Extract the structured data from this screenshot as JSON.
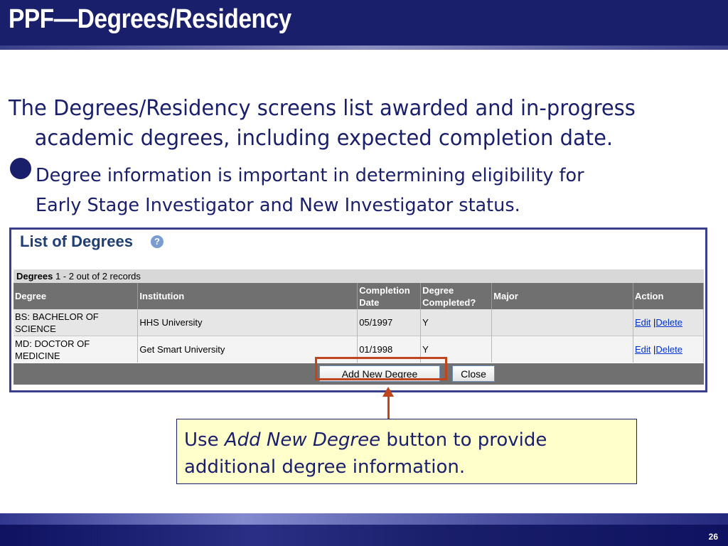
{
  "slide": {
    "title": "PPF—Degrees/Residency",
    "lead_line1": "The Degrees/Residency screens list awarded and in-progress",
    "lead_line2": "academic degrees, including expected completion date.",
    "bullet_line1": "Degree information is important in determining eligibility for",
    "bullet_line2": "Early Stage Investigator and New Investigator status.",
    "page_number": "26"
  },
  "screen": {
    "title": "List of Degrees",
    "records_label": "Degrees",
    "records_text": "1 - 2 out of 2 records",
    "columns": {
      "degree": "Degree",
      "institution": "Institution",
      "completion_l1": "Completion",
      "completion_l2": "Date",
      "completed_l1": "Degree",
      "completed_l2": "Completed?",
      "major": "Major",
      "action": "Action"
    },
    "rows": [
      {
        "degree_l1": "BS: BACHELOR OF",
        "degree_l2": "SCIENCE",
        "institution": "HHS University",
        "completion_date": "05/1997",
        "completed": "Y",
        "major": "",
        "edit": "Edit",
        "sep": "|",
        "delete": "Delete"
      },
      {
        "degree_l1": "MD: DOCTOR OF",
        "degree_l2": "MEDICINE",
        "institution": "Get Smart University",
        "completion_date": "01/1998",
        "completed": "Y",
        "major": "",
        "edit": "Edit",
        "sep": "|",
        "delete": "Delete"
      }
    ],
    "add_button": "Add New Degree",
    "close_button": "Close"
  },
  "callout": {
    "prefix": "Use",
    "emphasis": "Add New Degree",
    "suffix": "button to provide",
    "line2": "additional degree information."
  },
  "colors": {
    "navy": "#1a1f6b",
    "highlight": "#c0441c",
    "callout_bg": "#ffffcc"
  }
}
